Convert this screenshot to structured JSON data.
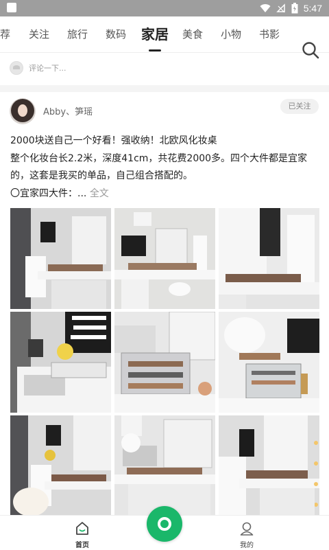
{
  "status_bar": {
    "time": "5:47",
    "icons": [
      "notification-icon",
      "wifi-icon",
      "no-signal-icon",
      "battery-icon"
    ]
  },
  "tabs": {
    "items": [
      {
        "label": "荐"
      },
      {
        "label": "关注"
      },
      {
        "label": "旅行"
      },
      {
        "label": "数码"
      },
      {
        "label": "家居",
        "active": true
      },
      {
        "label": "美食"
      },
      {
        "label": "小物"
      },
      {
        "label": "书影"
      }
    ],
    "search_icon": "search-icon"
  },
  "comment": {
    "placeholder": "评论一下..."
  },
  "post": {
    "author": "Abby、笋瑶",
    "follow_label": "已关注",
    "title": "2000块送自己一个好看！强收纳！北欧风化妆桌",
    "line1": "整个化妆台长2.2米，深度41cm，共花费2000多。四个大件都是宜家",
    "line2": "的，这套是我买的单品，自己组合搭配的。",
    "line3": "〇宜家四大件：...",
    "read_more": "全文",
    "photo_count": 9
  },
  "bottom_nav": {
    "home_label": "首页",
    "camera_icon": "camera-icon",
    "mine_label": "我的"
  },
  "colors": {
    "accent": "#1ab76a",
    "status_bar": "#9e9e9e",
    "text_primary": "#222222",
    "text_muted": "#999999"
  }
}
